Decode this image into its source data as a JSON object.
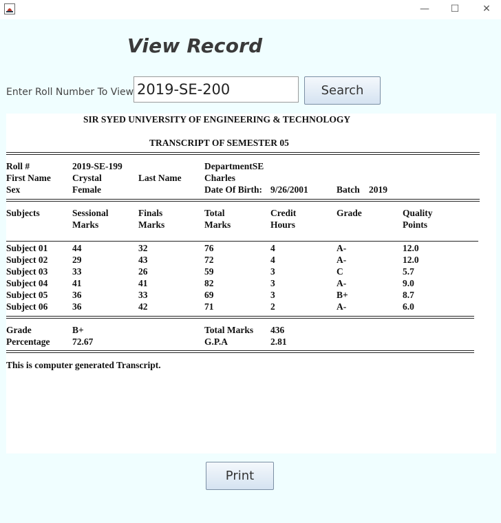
{
  "window": {
    "minimize": "—",
    "maximize": "☐",
    "close": "✕"
  },
  "heading": "View Record",
  "roll_label": "Enter Roll Number To View",
  "roll_input_value": "2019-SE-200",
  "search_label": "Search",
  "print_label": "Print",
  "transcript": {
    "university": "SIR SYED UNIVERSITY OF ENGINEERING & TECHNOLOGY",
    "title": "TRANSCRIPT  OF  SEMESTER  05",
    "roll_label": "Roll #",
    "roll_value": "2019-SE-199",
    "department": "DepartmentSE",
    "first_name_label": "First Name",
    "first_name": "Crystal",
    "last_name_label": "Last  Name",
    "last_name": "Charles",
    "sex_label": "Sex",
    "sex": "Female",
    "dob_label": "Date Of Birth:",
    "dob": "9/26/2001",
    "batch_label": "Batch",
    "batch": "2019",
    "headers": [
      [
        "Subjects",
        ""
      ],
      [
        "Sessional",
        "Marks"
      ],
      [
        "Finals",
        "Marks"
      ],
      [
        "Total",
        "Marks"
      ],
      [
        "Credit",
        "Hours"
      ],
      [
        "Grade",
        ""
      ],
      [
        "Quality",
        "Points"
      ]
    ],
    "rows": [
      [
        "Subject 01",
        "44",
        "32",
        "76",
        "4",
        "A-",
        "12.0"
      ],
      [
        "Subject 02",
        "29",
        "43",
        "72",
        "4",
        "A-",
        "12.0"
      ],
      [
        "Subject 03",
        "33",
        "26",
        "59",
        "3",
        "C",
        "5.7"
      ],
      [
        "Subject 04",
        "41",
        "41",
        "82",
        "3",
        "A-",
        "9.0"
      ],
      [
        "Subject 05",
        "36",
        "33",
        "69",
        "3",
        "B+",
        "8.7"
      ],
      [
        "Subject 06",
        "36",
        "42",
        "71",
        "2",
        "A-",
        "6.0"
      ]
    ],
    "grade_label": "Grade",
    "grade": "B+",
    "total_marks_label": "Total Marks",
    "total_marks": "436",
    "percentage_label": "Percentage",
    "percentage": "72.67",
    "gpa_label": "G.P.A",
    "gpa": "2.81",
    "footer": "This is computer generated Transcript."
  }
}
